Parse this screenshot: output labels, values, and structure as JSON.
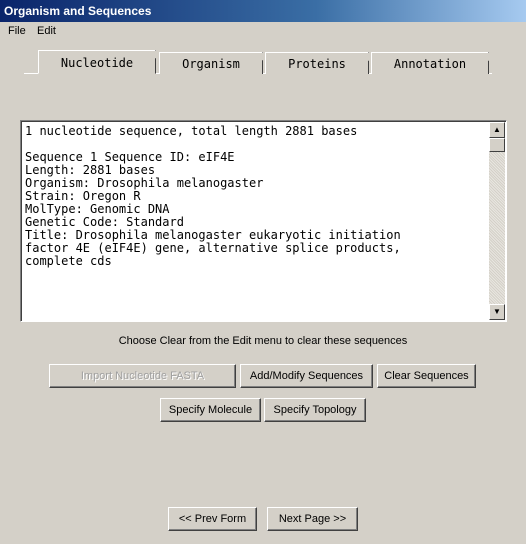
{
  "window": {
    "title": "Organism and Sequences"
  },
  "menu": {
    "file": "File",
    "edit": "Edit"
  },
  "tabs": [
    {
      "label": "Nucleotide",
      "active": true
    },
    {
      "label": "Organism"
    },
    {
      "label": "Proteins"
    },
    {
      "label": "Annotation"
    }
  ],
  "sequence_text": "1 nucleotide sequence, total length 2881 bases\n\nSequence 1 Sequence ID: eIF4E\nLength: 2881 bases\nOrganism: Drosophila melanogaster\nStrain: Oregon R\nMolType: Genomic DNA\nGenetic Code: Standard\nTitle: Drosophila melanogaster eukaryotic initiation\nfactor 4E (eIF4E) gene, alternative splice products,\ncomplete cds",
  "hint": "Choose Clear from the Edit menu to clear these sequences",
  "buttons": {
    "import": "Import Nucleotide FASTA",
    "add_modify": "Add/Modify Sequences",
    "clear": "Clear Sequences",
    "specify_molecule": "Specify Molecule",
    "specify_topology": "Specify Topology",
    "prev": "<< Prev Form",
    "next": "Next Page >>"
  }
}
